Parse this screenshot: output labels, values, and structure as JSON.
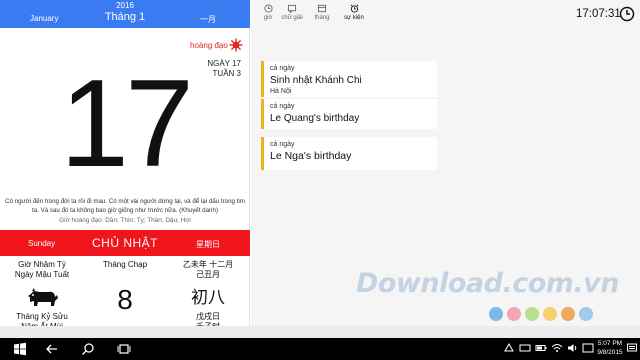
{
  "header": {
    "en_month": "January",
    "year": "2016",
    "vn_month": "Tháng 1",
    "cn_month": "一月"
  },
  "day": {
    "hoang_dao": "hoàng đạo",
    "number": "17",
    "day_of_year": "NGÀY 17",
    "week": "TUẦN 3",
    "quote": "Có người đến trong đời ta rồi đi mau. Có một vài người dừng lại, và để lại dấu trong tim ta. Và sau đó ta không bao giờ giống như trước nữa. (Khuyết danh)",
    "gio_hoang_dao": "Giờ hoàng đạo: Dần; Thìn; Tỵ; Thân; Dậu; Hợi",
    "en_weekday": "Sunday",
    "vn_weekday": "CHỦ NHẬT",
    "cn_weekday": "星期日"
  },
  "lunar": {
    "hour": "Giờ Nhâm Tý",
    "day_name": "Ngày Mậu Tuất",
    "month_name": "Tháng Kỷ Sửu",
    "year_name": "Năm Ất Mùi",
    "vn_month": "Tháng Chạp",
    "vn_day": "8",
    "cn_year_month": "乙未年 十二月",
    "cn_month_stem": "己丑月",
    "cn_day": "初八",
    "cn_day_stem": "戊戌日",
    "cn_hour": "壬子时"
  },
  "toolbar": {
    "items": [
      {
        "label": "giờ",
        "icon": "clock-icon"
      },
      {
        "label": "chữ giải",
        "icon": "message-icon"
      },
      {
        "label": "tháng",
        "icon": "calendar-icon"
      },
      {
        "label": "sự kiện",
        "icon": "alarm-icon"
      }
    ],
    "active": "sự kiện",
    "time": "17:07:31"
  },
  "events": [
    {
      "time": "cả ngày",
      "title": "Sinh nhật Khánh Chi",
      "place": "Hà Nội"
    },
    {
      "time": "cả ngày",
      "title": "Le Quang's birthday",
      "place": ""
    },
    {
      "time": "cả ngày",
      "title": "Le Nga's birthday",
      "place": ""
    }
  ],
  "watermark": {
    "text": "Download.com.vn",
    "dot_colors": [
      "#7fb8e6",
      "#f3a5b5",
      "#b8e08f",
      "#f5d36a",
      "#f0a860",
      "#9ecbe8"
    ]
  },
  "taskbar": {
    "time": "5:07 PM",
    "date": "9/8/2015"
  },
  "colors": {
    "blue": "#3a7bf1",
    "red": "#f0151b",
    "event_accent": "#f2b21b"
  }
}
